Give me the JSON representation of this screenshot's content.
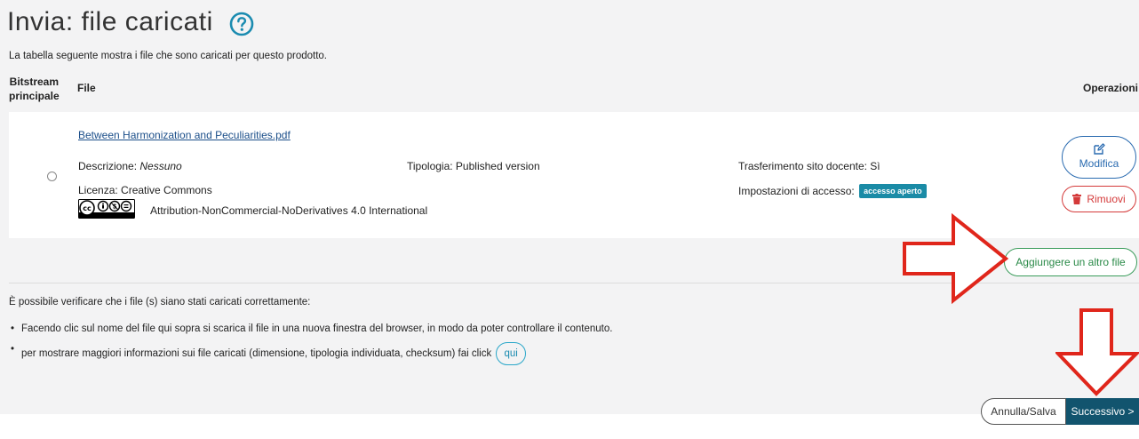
{
  "page": {
    "title": "Invia: file caricati",
    "subtitle": "La tabella seguente mostra i file che sono caricati per questo prodotto."
  },
  "table": {
    "headers": {
      "bitstream_line1": "Bitstream",
      "bitstream_line2": "principale",
      "file": "File",
      "operations": "Operazioni"
    },
    "row": {
      "file_name": "Between Harmonization and Peculiarities.pdf",
      "description_label": "Descrizione: ",
      "description_value": "Nessuno",
      "type": "Tipologia: Published version",
      "transfer": "Trasferimento sito docente: Sì",
      "license": "Licenza: Creative Commons",
      "access_label": "Impostazioni di accesso:",
      "access_badge": "accesso aperto",
      "license_text": "Attribution-NonCommercial-NoDerivatives 4.0 International",
      "modify_label": "Modifica",
      "remove_label": "Rimuovi"
    }
  },
  "add_file_label": "Aggiungere un altro file",
  "verify": {
    "intro": "È possibile verificare che i file (s) siano stati caricati correttamente:",
    "bullet1": "Facendo clic sul nome del file qui sopra si scarica il file in una nuova finestra del browser, in modo da poter controllare il contenuto.",
    "bullet2": "per mostrare maggiori informazioni sui file caricati (dimensione, tipologia individuata, checksum) fai click",
    "qui_label": "qui"
  },
  "footer": {
    "cancel_label": "Annulla/Salva",
    "next_label": "Successivo >"
  },
  "icons": {
    "help": "help-circle-icon",
    "edit": "edit-icon",
    "trash": "trash-icon",
    "cc": "creative-commons-badge",
    "annotation": "red-outline-arrow"
  },
  "colors": {
    "accent_blue": "#2a6bb0",
    "danger_red": "#d43a3a",
    "success_green": "#3a9c5a",
    "primary_dark": "#12546e",
    "badge_teal": "#1a8ba6",
    "annotation_red": "#e0261b"
  }
}
